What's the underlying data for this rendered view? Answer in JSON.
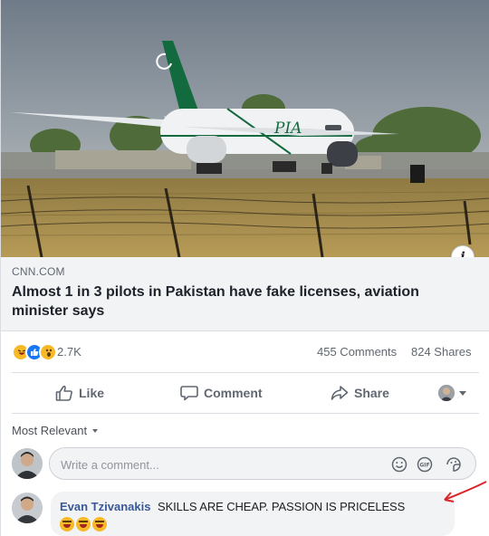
{
  "hero": {
    "icon": "info-icon",
    "badge_label": "i",
    "aircraft_livery": "PIA",
    "colors": {
      "sky": "#7e8a96",
      "grass": "#a78d51",
      "tail": "#136a3f"
    }
  },
  "link_preview": {
    "source": "CNN.COM",
    "title": "Almost 1 in 3 pilots in Pakistan have fake licenses, aviation minister says"
  },
  "stats": {
    "reaction_icons": [
      "haha-reaction-icon",
      "like-reaction-icon",
      "wow-reaction-icon"
    ],
    "reaction_count": "2.7K",
    "comments": "455 Comments",
    "shares": "824 Shares"
  },
  "actions": {
    "like": "Like",
    "comment": "Comment",
    "share": "Share"
  },
  "comments": {
    "filter_label": "Most Relevant",
    "composer_placeholder": "Write a comment...",
    "items": [
      {
        "author": "Evan Tzivanakis",
        "text": "SKILLS ARE CHEAP. PASSION IS PRICELESS"
      }
    ]
  },
  "colors": {
    "link_blue": "#385898",
    "muted_text": "#606770",
    "annotation_red": "#d9262b",
    "like_blue": "#1877f2"
  }
}
